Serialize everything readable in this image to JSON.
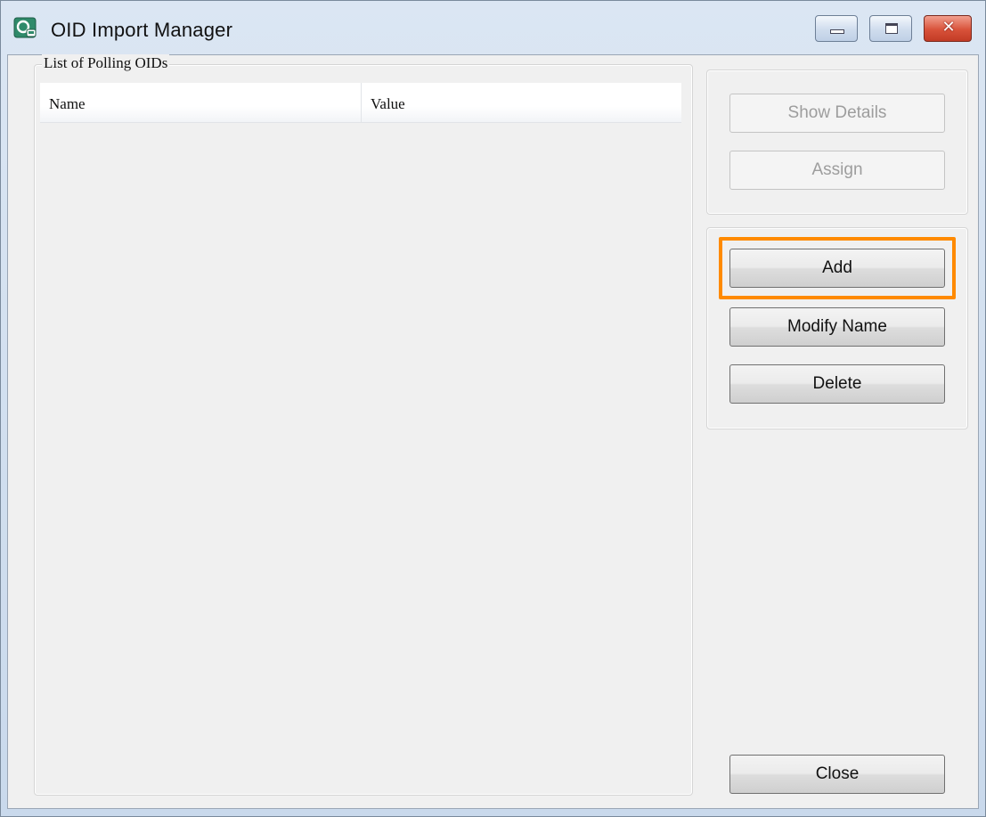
{
  "window": {
    "title": "OID Import Manager",
    "controls": {
      "minimize": "minimize",
      "maximize": "maximize",
      "close": "✕"
    }
  },
  "list_group": {
    "legend": "List of Polling OIDs",
    "columns": [
      "Name",
      "Value"
    ],
    "rows": []
  },
  "actions_top": {
    "show_details": "Show Details",
    "assign": "Assign"
  },
  "actions_mid": {
    "add": "Add",
    "modify_name": "Modify Name",
    "delete": "Delete"
  },
  "footer": {
    "close": "Close"
  },
  "colors": {
    "highlight": "#ff8a00",
    "client_bg": "#f0f0f0",
    "close_button": "#c23b25"
  }
}
